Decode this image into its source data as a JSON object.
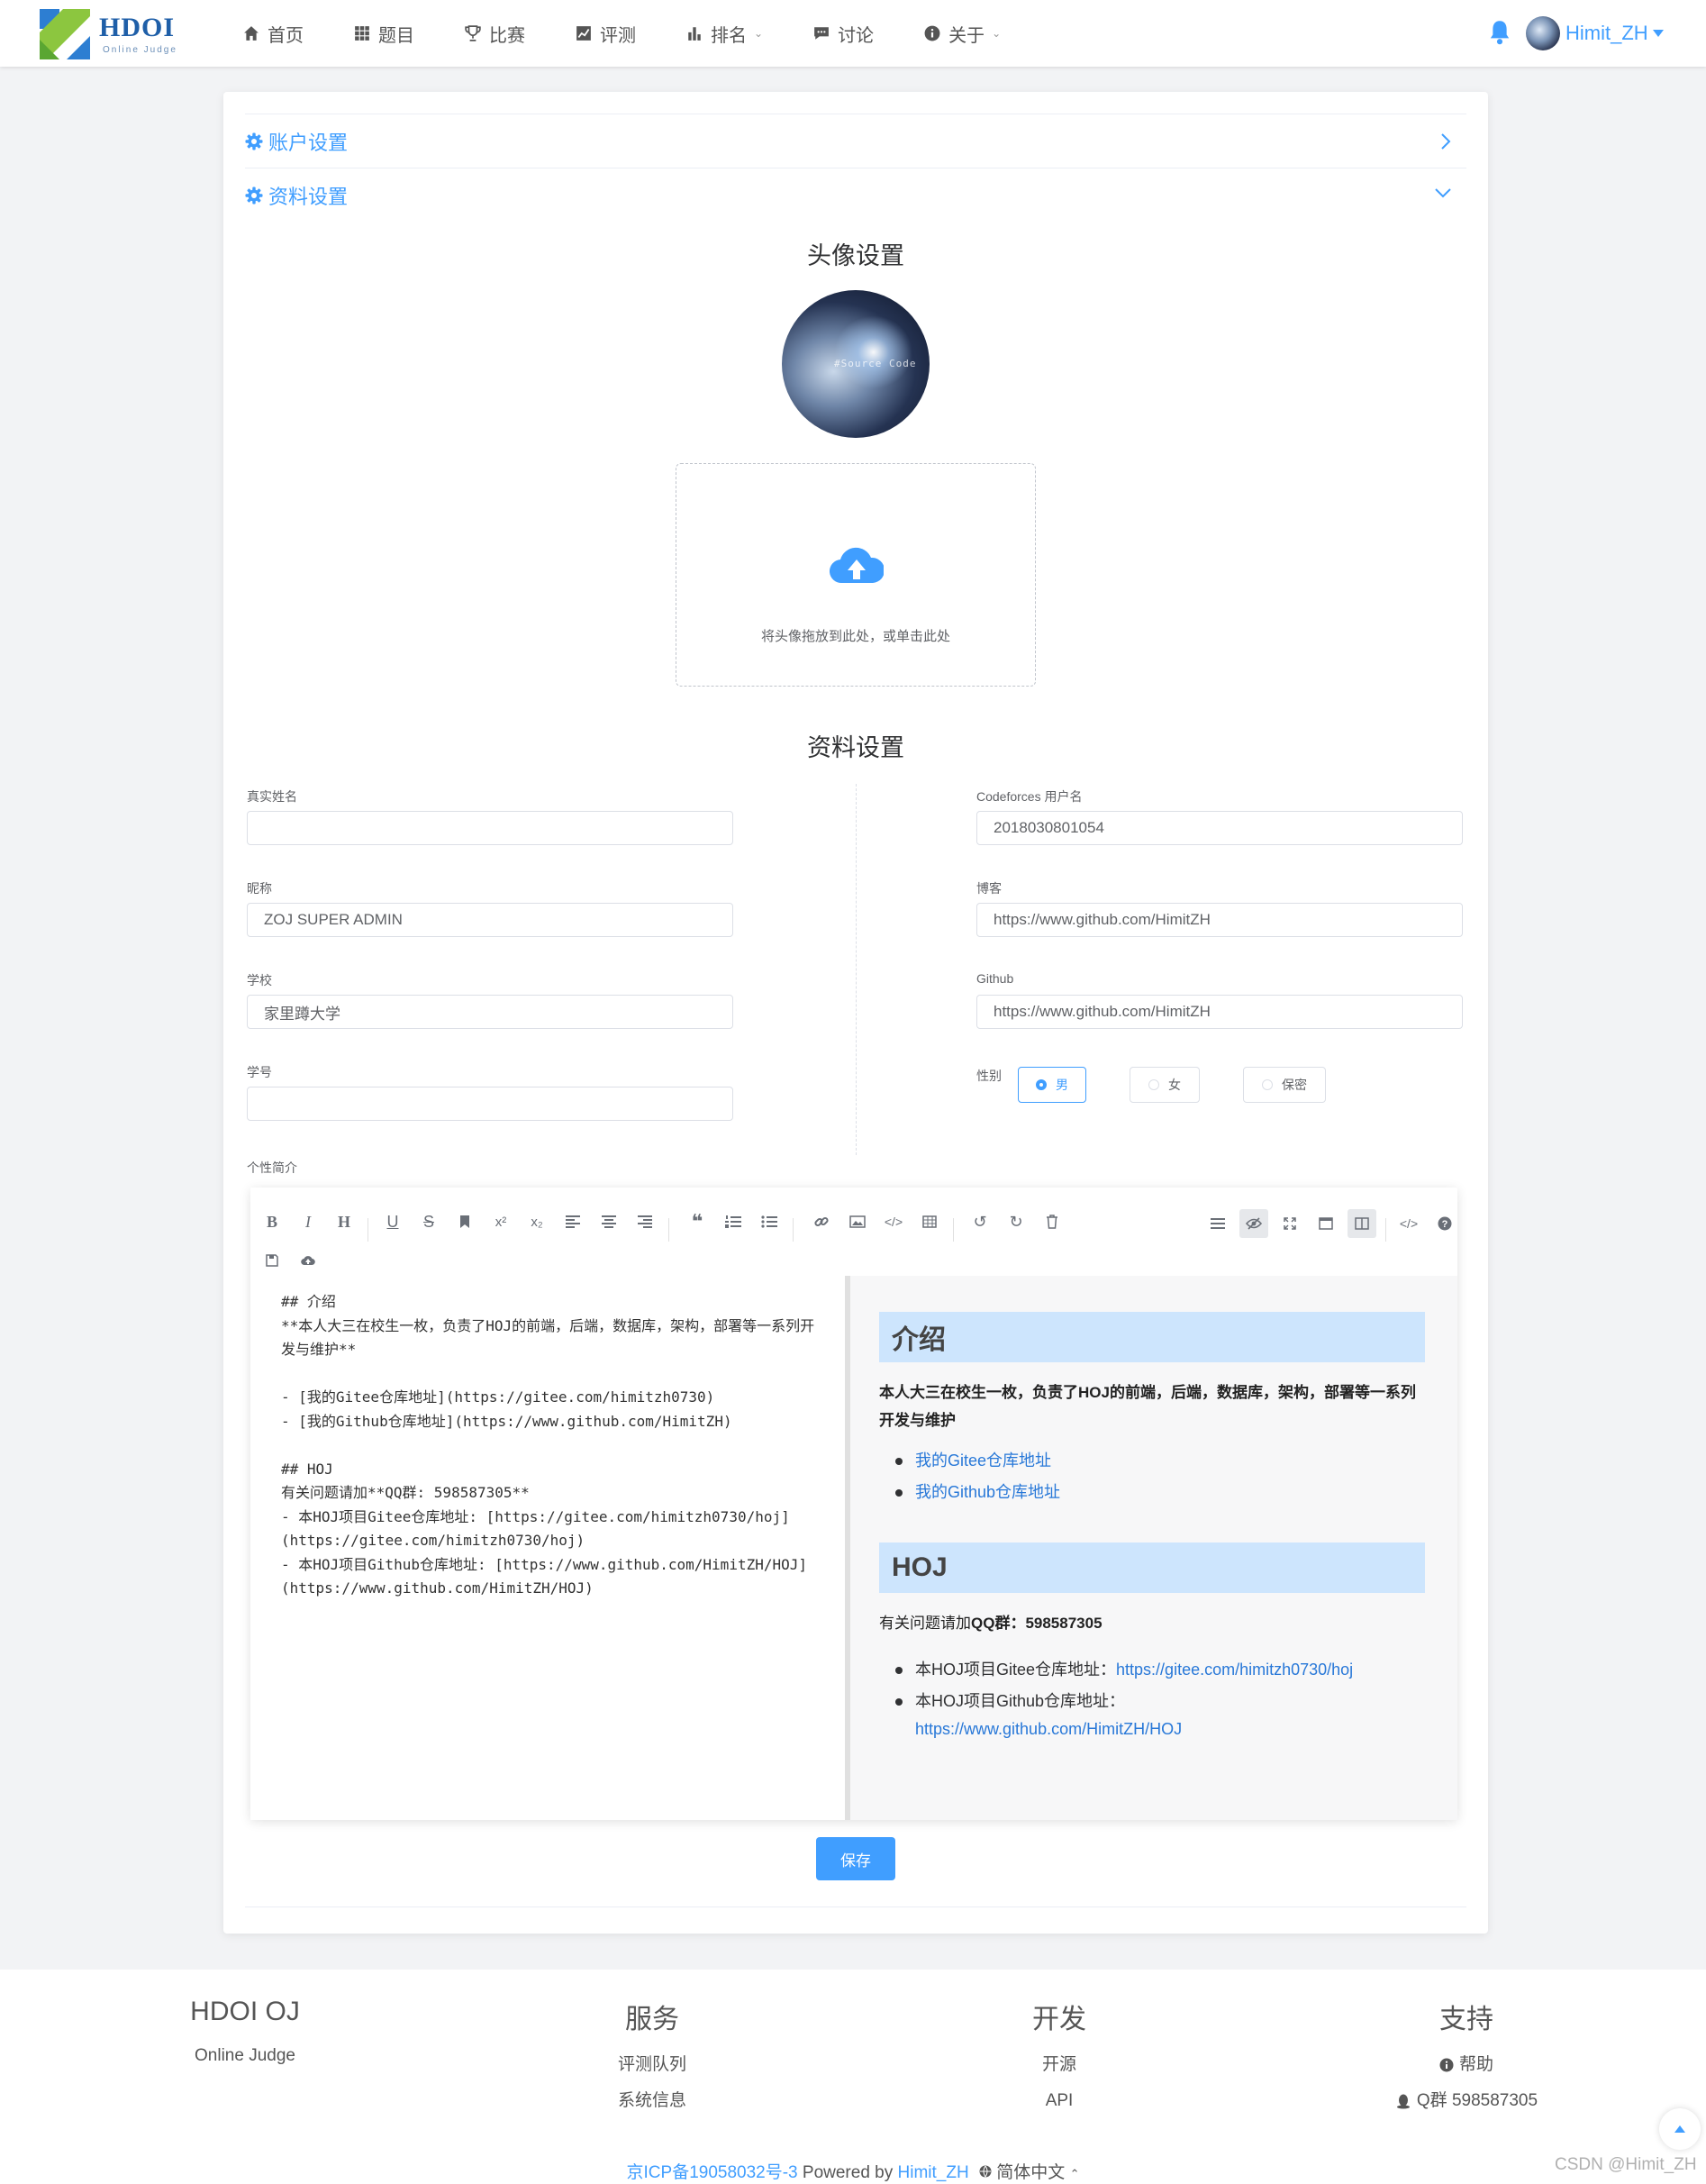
{
  "header": {
    "logo_text": "HDOI",
    "logo_sub": "Online Judge",
    "nav": [
      {
        "label": "首页",
        "icon": "home-icon"
      },
      {
        "label": "题目",
        "icon": "grid-icon"
      },
      {
        "label": "比赛",
        "icon": "trophy-icon"
      },
      {
        "label": "评测",
        "icon": "chart-line-icon"
      },
      {
        "label": "排名",
        "icon": "bar-chart-icon",
        "dropdown": true
      },
      {
        "label": "讨论",
        "icon": "comment-icon"
      },
      {
        "label": "关于",
        "icon": "info-icon",
        "dropdown": true
      }
    ],
    "username": "Himit_ZH"
  },
  "settings": {
    "account_title": "账户设置",
    "profile_title": "资料设置",
    "avatar_title": "头像设置",
    "avatar_watermark": "#Source Code",
    "upload_hint": "将头像拖放到此处，或单击此处",
    "profile_section_title": "资料设置"
  },
  "form": {
    "realname": {
      "label": "真实姓名",
      "value": ""
    },
    "nickname": {
      "label": "昵称",
      "value": "ZOJ SUPER ADMIN"
    },
    "school": {
      "label": "学校",
      "value": "家里蹲大学"
    },
    "student_no": {
      "label": "学号",
      "value": ""
    },
    "codeforces": {
      "label": "Codeforces 用户名",
      "value": "2018030801054"
    },
    "blog": {
      "label": "博客",
      "value": "https://www.github.com/HimitZH"
    },
    "github": {
      "label": "Github",
      "value": "https://www.github.com/HimitZH"
    },
    "gender": {
      "label": "性别",
      "options": [
        "男",
        "女",
        "保密"
      ],
      "selected": "男"
    },
    "bio_label": "个性简介"
  },
  "editor": {
    "source": "## 介绍\n**本人大三在校生一枚，负责了HOJ的前端，后端，数据库，架构，部署等一系列开发与维护**\n\n- [我的Gitee仓库地址](https://gitee.com/himitzh0730)\n- [我的Github仓库地址](https://www.github.com/HimitZH)\n\n## HOJ\n有关问题请加**QQ群: 598587305**\n- 本HOJ项目Gitee仓库地址: [https://gitee.com/himitzh0730/hoj](https://gitee.com/himitzh0730/hoj)\n- 本HOJ项目Github仓库地址: [https://www.github.com/HimitZH/HOJ](https://www.github.com/HimitZH/HOJ)",
    "preview": {
      "h1": "介绍",
      "p1": "本人大三在校生一枚，负责了HOJ的前端，后端，数据库，架构，部署等一系列开发与维护",
      "link1": "我的Gitee仓库地址",
      "link2": "我的Github仓库地址",
      "h2": "HOJ",
      "p2_prefix": "有关问题请加",
      "p2_bold": "QQ群：598587305",
      "li3_prefix": "本HOJ项目Gitee仓库地址：",
      "li3_link": "https://gitee.com/himitzh0730/hoj",
      "li4_prefix": "本HOJ项目Github仓库地址：",
      "li4_link": "https://www.github.com/HimitZH/HOJ"
    }
  },
  "save_label": "保存",
  "footer": {
    "col1": {
      "title": "HDOI OJ",
      "items": [
        "Online Judge"
      ]
    },
    "col2": {
      "title": "服务",
      "items": [
        "评测队列",
        "系统信息"
      ]
    },
    "col3": {
      "title": "开发",
      "items": [
        "开源",
        "API"
      ]
    },
    "col4": {
      "title": "支持",
      "items": [
        "帮助",
        "Q群 598587305"
      ]
    },
    "icp": "京ICP备19058032号-3",
    "powered": "Powered by",
    "author": "Himit_ZH",
    "lang": "简体中文"
  },
  "watermark": "CSDN @Himit_ZH",
  "colors": {
    "accent": "#409eff",
    "heading_bg": "#cde5fd"
  }
}
